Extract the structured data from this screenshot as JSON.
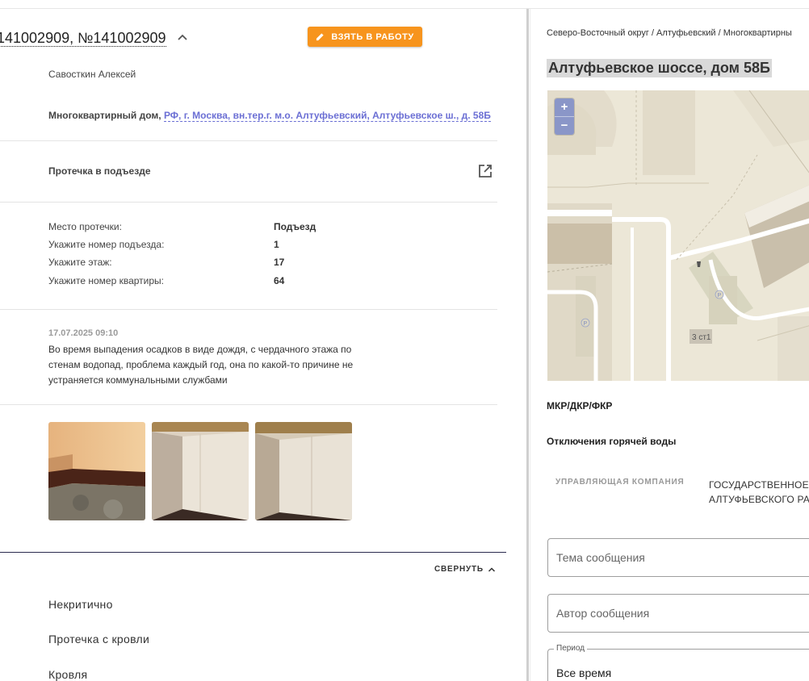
{
  "ticket": {
    "title": "141002909, №141002909",
    "work_button": "ВЗЯТЬ В РАБОТУ",
    "author": "Савосткин Алексей",
    "object_label": "Многоквартирный дом,",
    "object_link": "РФ, г. Москва, вн.тер.г. м.о. Алтуфьевский, Алтуфьевское ш., д. 58Б",
    "problem": "Протечка в подъезде",
    "details": [
      {
        "key": "Место протечки:",
        "value": "Подъезд"
      },
      {
        "key": "Укажите номер подъезда:",
        "value": "1"
      },
      {
        "key": "Укажите этаж:",
        "value": "17"
      },
      {
        "key": "Укажите номер квартиры:",
        "value": "64"
      }
    ],
    "message_date": "17.07.2025 09:10",
    "message_text": "Во время выпадения осадков в виде дождя, с чердачного этажа по стенам водопад, проблема каждый год, она по какой-то причине не устраняется коммунальными службами",
    "collapse_label": "СВЕРНУТЬ",
    "categories": [
      "Некритично",
      "Протечка с кровли",
      "Кровля"
    ]
  },
  "side": {
    "breadcrumbs": "Северо-Восточный округ / Алтуфьевский / Многоквартирны",
    "address": "Алтуфьевское шоссе, дом 58Б",
    "map": {
      "zoom_in": "+",
      "zoom_out": "−",
      "building_label": "3 ст1",
      "parking": "P"
    },
    "programs_label": "МКР/ДКР/ФКР",
    "hot_water_label": "Отключения горячей воды",
    "management_label": "УПРАВЛЯЮЩАЯ КОМПАНИЯ",
    "management_value": "ГОСУДАРСТВЕННОЕ Б АЛТУФЬЕВСКОГО РАЙ",
    "subject_placeholder": "Тема сообщения",
    "author_placeholder": "Автор сообщения",
    "period_legend": "Период",
    "period_value": "Все время"
  },
  "colors": {
    "accent": "#f7941d",
    "link": "#6b6fd4",
    "zoom": "#8a96c8"
  }
}
